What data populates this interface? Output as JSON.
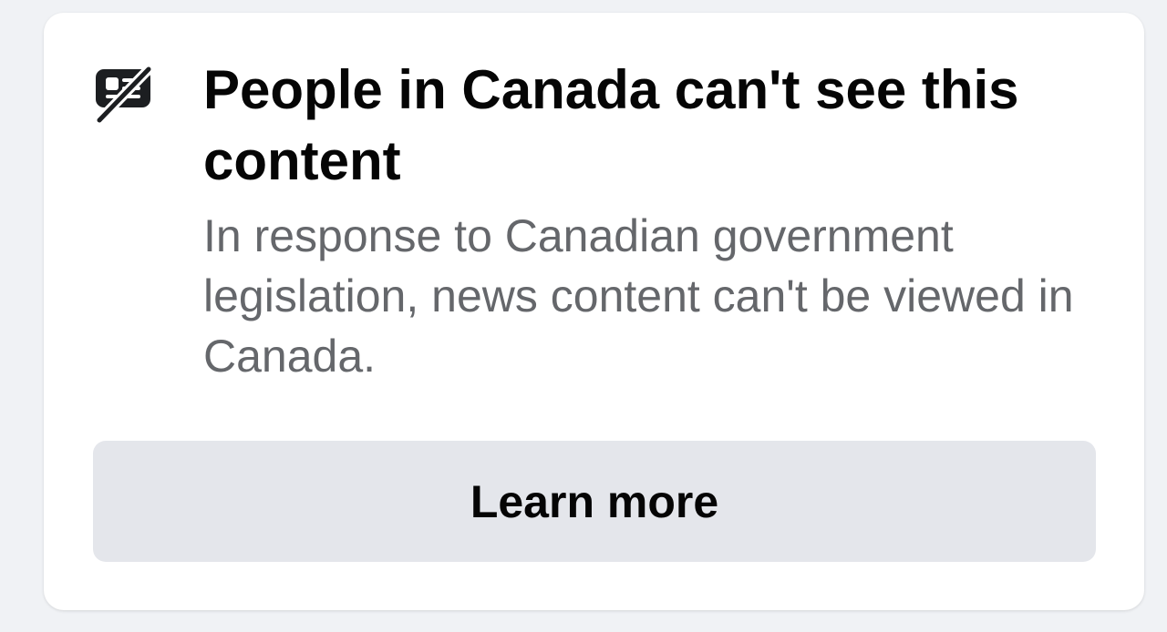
{
  "notice": {
    "icon": "news-blocked-icon",
    "title": "People in Canada can't see this content",
    "description": "In response to Canadian government legislation, news content can't be viewed in Canada.",
    "button_label": "Learn more"
  },
  "colors": {
    "page_background": "#f0f2f5",
    "card_background": "#ffffff",
    "title": "#050505",
    "description": "#65676b",
    "button_background": "#e4e6eb"
  }
}
